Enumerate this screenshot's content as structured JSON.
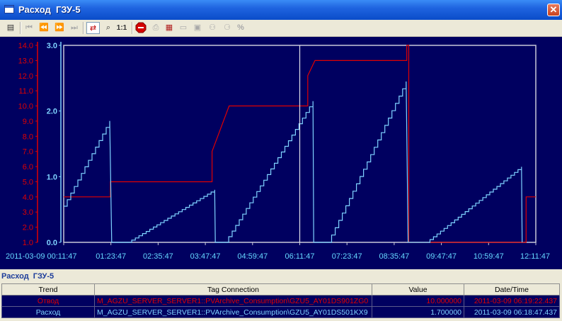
{
  "window": {
    "title": "Расход  ГЗУ-5"
  },
  "toolbar": {
    "scale_label": "1:1",
    "percent_label": "%"
  },
  "colors": {
    "background": "#000060",
    "series_red": "#e00000",
    "series_blue": "#7fd3ff",
    "time_label": "#66d8ff"
  },
  "chart_data": {
    "type": "line",
    "x_labels": [
      "2011-03-09 00:11:47",
      "01:23:47",
      "02:35:47",
      "03:47:47",
      "04:59:47",
      "06:11:47",
      "07:23:47",
      "08:35:47",
      "09:47:47",
      "10:59:47",
      "12:11:47"
    ],
    "x_range": [
      "2011-03-09 00:11:47",
      "2011-03-09 12:11:47"
    ],
    "cursor_time": "2011-03-09 06:11:47",
    "axes": [
      {
        "side": "left",
        "color": "red",
        "ylim": [
          1.0,
          14.0
        ],
        "ticks": [
          "14.0",
          "13.0",
          "12.0",
          "11.0",
          "10.0",
          "9.0",
          "8.0",
          "7.0",
          "6.0",
          "5.0",
          "4.0",
          "3.0",
          "2.0",
          "1.0"
        ]
      },
      {
        "side": "left",
        "color": "blue",
        "ylim": [
          0.0,
          3.0
        ],
        "ticks": [
          "3.0",
          "2.0",
          "1.0",
          "0.0"
        ]
      }
    ],
    "series": [
      {
        "name": "Отвод",
        "axis": 0,
        "points": [
          [
            "2011-03-09 00:11:47",
            4.0
          ],
          [
            "2011-03-09 01:23:00",
            4.0
          ],
          [
            "2011-03-09 01:23:00",
            5.0
          ],
          [
            "2011-03-09 03:58:00",
            5.0
          ],
          [
            "2011-03-09 03:58:00",
            7.0
          ],
          [
            "2011-03-09 04:24:00",
            10.0
          ],
          [
            "2011-03-09 06:24:00",
            10.0
          ],
          [
            "2011-03-09 06:24:00",
            12.0
          ],
          [
            "2011-03-09 06:35:00",
            13.0
          ],
          [
            "2011-03-09 08:55:00",
            13.0
          ],
          [
            "2011-03-09 08:55:00",
            14.0
          ],
          [
            "2011-03-09 08:58:00",
            14.0
          ],
          [
            "2011-03-09 08:58:00",
            1.0
          ],
          [
            "2011-03-09 11:57:00",
            1.0
          ],
          [
            "2011-03-09 11:57:00",
            4.0
          ],
          [
            "2011-03-09 12:11:47",
            4.0
          ]
        ]
      },
      {
        "name": "Расход",
        "axis": 1,
        "ramps": [
          {
            "start": [
              "2011-03-09 00:11:47",
              0.55
            ],
            "end": [
              "2011-03-09 01:22:00",
              1.85
            ],
            "drop_to": [
              "2011-03-09 01:25:00",
              0.0
            ]
          },
          {
            "start": [
              "2011-03-09 01:50:00",
              0.0
            ],
            "end": [
              "2011-03-09 04:02:00",
              0.8
            ],
            "drop_to": [
              "2011-03-09 04:03:00",
              0.0
            ]
          },
          {
            "start": [
              "2011-03-09 04:18:00",
              0.0
            ],
            "end": [
              "2011-03-09 06:32:00",
              2.15
            ],
            "drop_to": [
              "2011-03-09 06:33:00",
              0.0
            ]
          },
          {
            "start": [
              "2011-03-09 06:55:00",
              0.0
            ],
            "end": [
              "2011-03-09 08:54:00",
              2.45
            ],
            "drop_to": [
              "2011-03-09 08:57:00",
              0.0
            ]
          },
          {
            "start": [
              "2011-03-09 09:25:00",
              0.0
            ],
            "end": [
              "2011-03-09 11:50:00",
              1.15
            ],
            "drop_to": [
              "2011-03-09 11:51:00",
              0.0
            ]
          }
        ]
      }
    ]
  },
  "trend": {
    "title": "Расход  ГЗУ-5",
    "columns": [
      "Trend",
      "Tag Connection",
      "Value",
      "Date/Time"
    ],
    "rows": [
      {
        "trend": "Отвод",
        "tag": "M_AGZU_SERVER_SERVER1::PVArchive_Consumption\\GZU5_AY01DS901ZG0",
        "value": "10.000000",
        "datetime": "2011-03-09 06:19:22.437"
      },
      {
        "trend": "Расход",
        "tag": "M_AGZU_SERVER_SERVER1::PVArchive_Consumption\\GZU5_AY01DS501KX9",
        "value": "1.700000",
        "datetime": "2011-03-09 06:18:47.437"
      }
    ]
  }
}
